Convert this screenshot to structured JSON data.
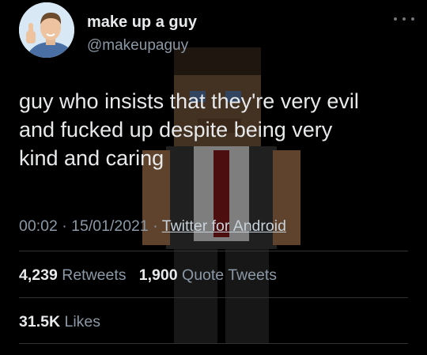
{
  "author": {
    "display_name": "make up a guy",
    "handle": "@makeupaguy"
  },
  "tweet": {
    "text_lines": [
      "guy who insists that they're very evil",
      "and fucked up despite being very",
      "kind and caring"
    ]
  },
  "meta": {
    "time": "00:02",
    "separator": "·",
    "date": "15/01/2021",
    "source": "Twitter for Android"
  },
  "stats": {
    "retweets_count": "4,239",
    "retweets_label": "Retweets",
    "quotes_count": "1,900",
    "quotes_label": "Quote Tweets",
    "likes_count": "31.5K",
    "likes_label": "Likes"
  },
  "icons": {
    "more": "more-options-icon",
    "avatar": "avatar-thumbs-up-photo"
  },
  "colors": {
    "background": "#000000",
    "text": "#e7e9ea",
    "secondary": "#8b98a5"
  }
}
